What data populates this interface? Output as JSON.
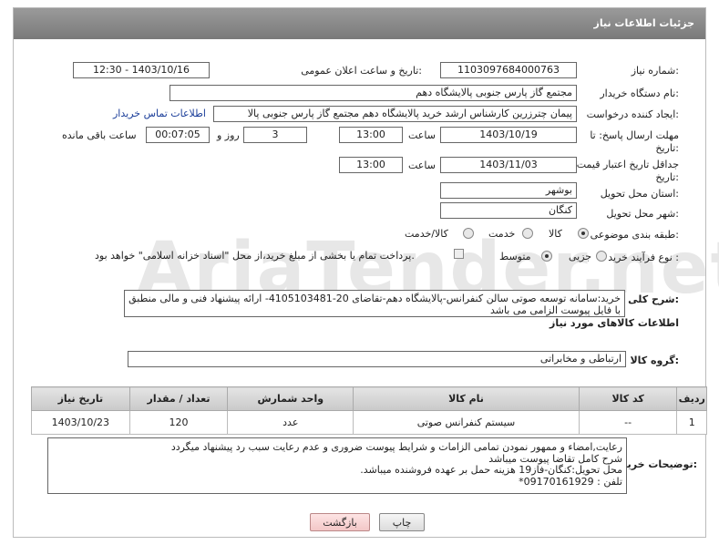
{
  "header": {
    "title": "جزئیات اطلاعات نیاز"
  },
  "fields": {
    "need_number": {
      "label": "شماره نیاز:",
      "value": "1103097684000763"
    },
    "announce_datetime": {
      "label": "تاریخ و ساعت اعلان عمومی:",
      "value": "1403/10/16 - 12:30"
    },
    "buyer_org": {
      "label": "نام دستگاه خریدار:",
      "value": "مجتمع گاز پارس جنوبی  پالایشگاه دهم"
    },
    "requester": {
      "label": "ایجاد کننده درخواست:",
      "value": "پیمان چترزرین کارشناس ارشد خرید پالایشگاه دهم مجتمع گاز پارس جنوبی  پالا",
      "contact_link": "اطلاعات تماس خریدار"
    },
    "reply_deadline": {
      "label": "مهلت ارسال پاسخ: تا تاریخ:",
      "date": "1403/10/19",
      "time_label": "ساعت",
      "time": "13:00",
      "days": "3",
      "days_label": "روز و",
      "remaining": "00:07:05",
      "remaining_label": "ساعت باقی مانده"
    },
    "price_validity": {
      "label": "جداقل تاریخ اعتبار قیمت: تا تاریخ:",
      "date": "1403/11/03",
      "time_label": "ساعت",
      "time": "13:00"
    },
    "province": {
      "label": "استان محل تحویل:",
      "value": "بوشهر"
    },
    "city": {
      "label": "شهر محل تحویل:",
      "value": "کنگان"
    },
    "category": {
      "label": "طبقه بندی موضوعی:",
      "options": [
        "کالا",
        "خدمت",
        "کالا/خدمت"
      ]
    },
    "process_type": {
      "label": "نوع فرآیند خرید :",
      "options": [
        "جزیی",
        "متوسط"
      ],
      "payment_note": "پرداخت تمام یا بخشی از مبلغ خرید،از محل \"اسناد خزانه اسلامی\" خواهد بود."
    }
  },
  "description": {
    "label": "شرح کلی نیاز:",
    "value": "خرید:سامانه توسعه صوتی سالن کنفرانس-پالایشگاه دهم-تقاضای 20-4105103481- ارائه پیشنهاد فنی و مالی منطبق با فایل پیوست الزامی می باشد"
  },
  "goods_section": {
    "title": "اطلاعات کالاهای مورد نیاز",
    "group_label": "گروه کالا:",
    "group_value": "ارتباطی و مخابراتی",
    "columns": [
      "ردیف",
      "کد کالا",
      "نام کالا",
      "واحد شمارش",
      "تعداد / مقدار",
      "تاریخ نیاز"
    ],
    "rows": [
      {
        "row": "1",
        "code": "--",
        "name": "سیستم کنفرانس صوتی",
        "unit": "عدد",
        "qty": "120",
        "date": "1403/10/23"
      }
    ]
  },
  "buyer_notes": {
    "label": "توضیحات خریدار:",
    "value": "رعایت,امضاء و ممهور نمودن تمامی الزامات و شرایط پیوست ضروری و عدم رعایت سبب رد پیشنهاد میگردد\nشرح کامل تقاضا پیوست میباشد\nمحل تحویل:کنگان-فاز19 هزینه حمل بر عهده فروشنده میباشد.\nتلفن : 09170161929*"
  },
  "buttons": {
    "print": "چاپ",
    "back": "بازگشت"
  },
  "watermark": "AriaTender.net"
}
